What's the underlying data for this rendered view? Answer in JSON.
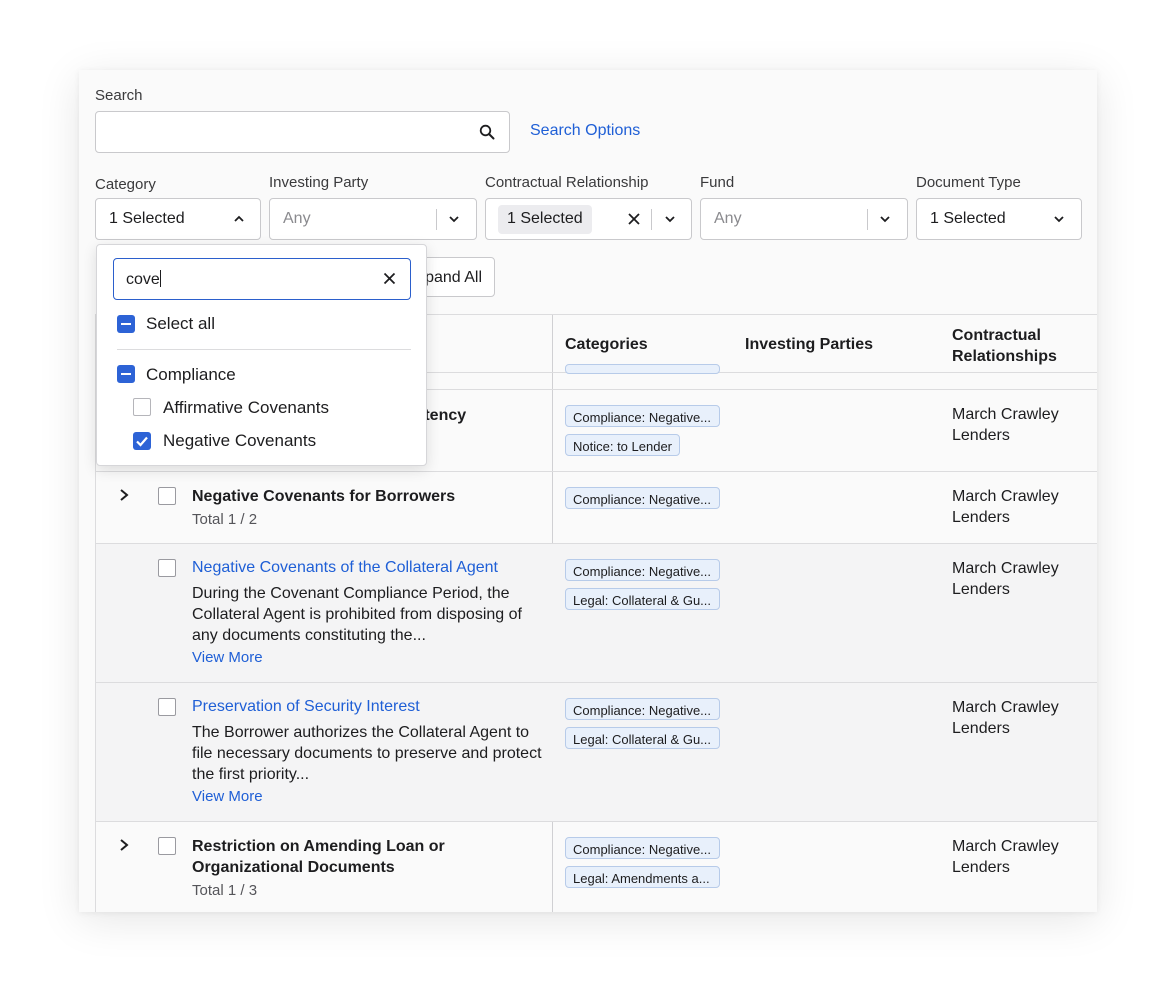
{
  "search": {
    "label": "Search",
    "value": "",
    "options_link": "Search Options"
  },
  "filters": {
    "category": {
      "label": "Category",
      "value": "1 Selected"
    },
    "investing_party": {
      "label": "Investing Party",
      "value": "Any"
    },
    "contractual_relationship": {
      "label": "Contractual Relationship",
      "value": "1 Selected"
    },
    "fund": {
      "label": "Fund",
      "value": "Any"
    },
    "document_type": {
      "label": "Document Type",
      "value": "1 Selected"
    }
  },
  "expand_button": {
    "label": "pand All"
  },
  "table": {
    "headers": {
      "categories": "Categories",
      "investing_parties": "Investing Parties",
      "contractual_relationships": "Contractual Relationships"
    },
    "rows": [
      {
        "title_partial": "istency",
        "tags": [
          "Compliance: Negative...",
          "Notice: to Lender"
        ],
        "relationship": "March Crawley Lenders"
      },
      {
        "title": "Negative Covenants for Borrowers",
        "total": "Total 1 / 2",
        "tags": [
          "Compliance: Negative..."
        ],
        "relationship": "March Crawley Lenders"
      },
      {
        "title": "Negative Covenants of the Collateral Agent",
        "description": "During the Covenant Compliance Period, the Collateral Agent is prohibited from disposing of any documents constituting the...",
        "view_more": "View More",
        "tags": [
          "Compliance: Negative...",
          "Legal: Collateral & Gu..."
        ],
        "relationship": "March Crawley Lenders"
      },
      {
        "title": "Preservation of Security Interest",
        "description": "The Borrower authorizes the Collateral Agent to file necessary documents to preserve and protect the first priority...",
        "view_more": "View More",
        "tags": [
          "Compliance: Negative...",
          "Legal: Collateral & Gu..."
        ],
        "relationship": "March Crawley Lenders"
      },
      {
        "title": "Restriction on Amending Loan or Organizational Documents",
        "total": "Total 1 / 3",
        "tags": [
          "Compliance: Negative...",
          "Legal: Amendments a..."
        ],
        "relationship": "March Crawley Lenders"
      }
    ]
  },
  "dropdown": {
    "query": "cove",
    "select_all": "Select all",
    "group": "Compliance",
    "items": [
      {
        "label": "Affirmative Covenants",
        "checked": false
      },
      {
        "label": "Negative Covenants",
        "checked": true
      }
    ]
  },
  "colors": {
    "accent": "#2d63d6",
    "link": "#1f5fd6",
    "tag_bg": "#e8f0fb"
  }
}
